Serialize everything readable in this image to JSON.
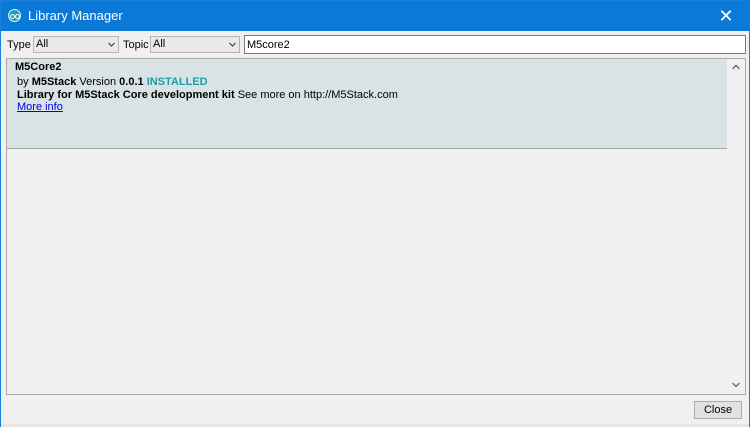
{
  "window": {
    "title": "Library Manager",
    "close_glyph": "✕"
  },
  "filters": {
    "type_label": "Type",
    "type_value": "All",
    "topic_label": "Topic",
    "topic_value": "All",
    "search_value": "M5core2"
  },
  "libraries": [
    {
      "name": "M5Core2",
      "by_prefix": "by",
      "author": "M5Stack",
      "version_prefix": "Version",
      "version": "0.0.1",
      "status": "INSTALLED",
      "summary": "Library for M5Stack Core development kit",
      "description": "See more on http://M5Stack.com",
      "more_info": "More info"
    }
  ],
  "footer": {
    "close_label": "Close"
  },
  "colors": {
    "titlebar": "#0a79d8",
    "installed": "#17a1a5",
    "entry_background": "#d9e3e6",
    "link": "#0000ee"
  },
  "icons": {
    "app": "arduino-icon",
    "close": "close-icon",
    "dropdown": "chevron-down-icon",
    "scroll_up": "chevron-up-icon",
    "scroll_down": "chevron-down-icon"
  }
}
